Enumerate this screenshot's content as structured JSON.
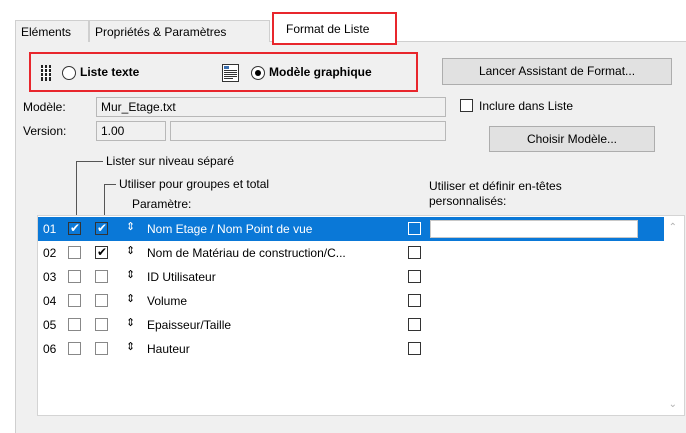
{
  "tabs": [
    {
      "label": "Eléments"
    },
    {
      "label": "Propriétés & Paramètres"
    },
    {
      "label": "Format de Liste"
    }
  ],
  "mode": {
    "text_label": "Liste texte",
    "graphic_label": "Modèle graphique",
    "selected": "graphic"
  },
  "wizard_button": "Lancer Assistant de Format...",
  "model": {
    "model_label": "Modèle:",
    "model_value": "Mur_Etage.txt",
    "version_label": "Version:",
    "version_value": "1.00",
    "include_label": "Inclure dans Liste",
    "choose_button": "Choisir Modèle..."
  },
  "headers": {
    "separate_level": "Lister sur niveau séparé",
    "groups_total": "Utiliser pour groupes et total",
    "parameter": "Paramètre:",
    "custom_headers_line1": "Utiliser et définir en-têtes",
    "custom_headers_line2": "personnalisés:"
  },
  "rows": [
    {
      "num": "01",
      "name": "Nom Etage / Nom Point de vue",
      "level": true,
      "group": true,
      "custom": false,
      "selected": true
    },
    {
      "num": "02",
      "name": "Nom de Matériau de construction/C...",
      "level": false,
      "group": true,
      "custom": false,
      "selected": false
    },
    {
      "num": "03",
      "name": "ID Utilisateur",
      "level": false,
      "group": false,
      "custom": false,
      "selected": false
    },
    {
      "num": "04",
      "name": "Volume",
      "level": false,
      "group": false,
      "custom": false,
      "selected": false
    },
    {
      "num": "05",
      "name": "Epaisseur/Taille",
      "level": false,
      "group": false,
      "custom": false,
      "selected": false
    },
    {
      "num": "06",
      "name": "Hauteur",
      "level": false,
      "group": false,
      "custom": false,
      "selected": false
    }
  ],
  "icons": {
    "text_mode": "text-list-icon",
    "graphic_mode": "graphic-template-icon",
    "sort": "sort-updown-icon",
    "scroll_up": "scroll-up-arrow-icon",
    "scroll_down": "scroll-down-arrow-icon"
  },
  "colors": {
    "highlight_red": "#e8262c",
    "selection_blue": "#0a78d7",
    "panel_bg": "#f0f0f0"
  }
}
